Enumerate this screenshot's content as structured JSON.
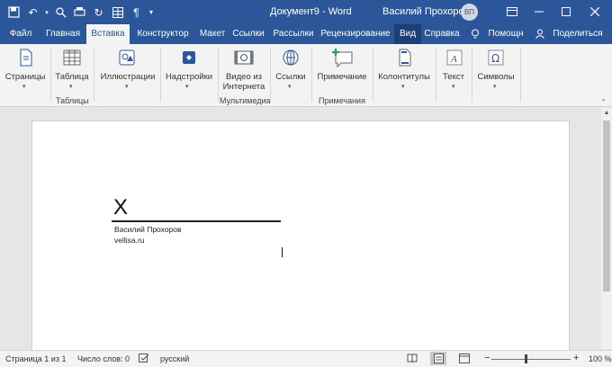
{
  "window": {
    "title": "Документ9 - Word",
    "user": "Василий Прохоров",
    "avatar_initials": "ВП",
    "colors": {
      "titlebar": "#2b579a",
      "ribbon": "#f3f3f3",
      "accent": "#2b579a"
    }
  },
  "tabs": [
    "Файл",
    "Главная",
    "Вставка",
    "Конструктор",
    "Макет",
    "Ссылки",
    "Рассылки",
    "Рецензирование",
    "Вид",
    "Справка",
    "Помощн",
    "Поделиться"
  ],
  "active_tab": "Вставка",
  "ribbon": {
    "pages": "Страницы",
    "table": "Таблица",
    "table_group": "Таблицы",
    "illustrations": "Иллюстрации",
    "addins": "Надстройки",
    "video_line1": "Видео из",
    "video_line2": "Интернета",
    "media_group": "Мультимедиа",
    "links": "Ссылки",
    "comment": "Примечание",
    "comments_group": "Примечания",
    "header_footer": "Колонтитулы",
    "text": "Текст",
    "symbols": "Символы"
  },
  "document": {
    "signature_mark": "X",
    "signer_name": "Василий Прохоров",
    "signer_site": "vellisa.ru"
  },
  "status": {
    "page": "Страница 1 из 1",
    "words": "Число слов: 0",
    "language": "русский",
    "zoom_level": "100 %",
    "zoom_minus": "−",
    "zoom_plus": "+"
  }
}
